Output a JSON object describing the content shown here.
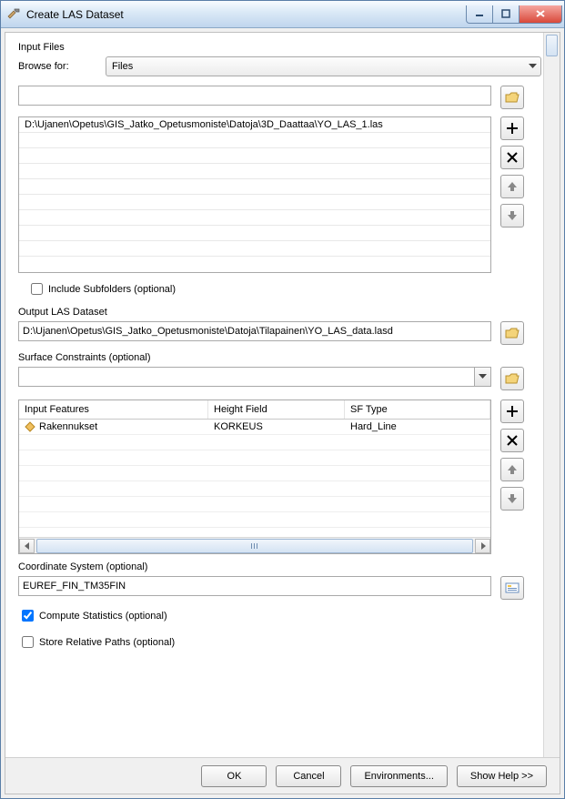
{
  "window": {
    "title": "Create LAS Dataset"
  },
  "input_files": {
    "section_label": "Input Files",
    "browse_for_label": "Browse for:",
    "browse_for_value": "Files",
    "path_value": "",
    "list_items": [
      "D:\\Ujanen\\Opetus\\GIS_Jatko_Opetusmoniste\\Datoja\\3D_Daattaa\\YO_LAS_1.las"
    ],
    "include_subfolders_label": "Include Subfolders (optional)",
    "include_subfolders_checked": false
  },
  "output": {
    "label": "Output LAS Dataset",
    "value": "D:\\Ujanen\\Opetus\\GIS_Jatko_Opetusmoniste\\Datoja\\Tilapainen\\YO_LAS_data.lasd"
  },
  "surface": {
    "label": "Surface Constraints (optional)",
    "value": "",
    "columns": {
      "c1": "Input Features",
      "c2": "Height Field",
      "c3": "SF Type"
    },
    "rows": [
      {
        "feature": "Rakennukset",
        "height": "KORKEUS",
        "sftype": "Hard_Line"
      }
    ]
  },
  "coord": {
    "label": "Coordinate System (optional)",
    "value": "EUREF_FIN_TM35FIN"
  },
  "compute_stats": {
    "label": "Compute Statistics (optional)",
    "checked": true
  },
  "store_paths": {
    "label": "Store Relative Paths (optional)",
    "checked": false
  },
  "buttons": {
    "ok": "OK",
    "cancel": "Cancel",
    "environments": "Environments...",
    "show_help": "Show Help >>"
  }
}
